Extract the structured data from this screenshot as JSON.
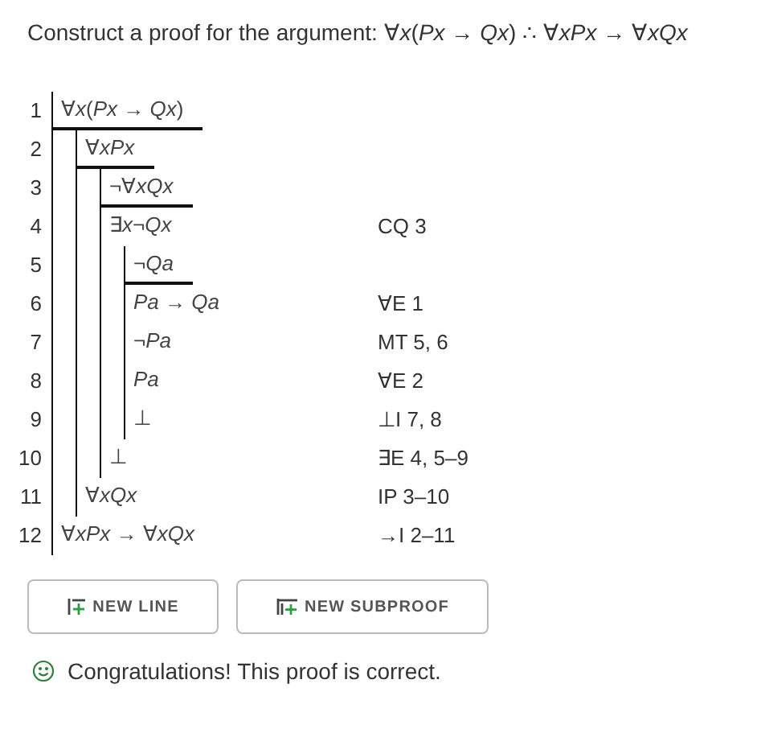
{
  "prompt": "Construct a proof for the argument: ∀*x*(*Px* → *Qx*) ∴ ∀*xPx* → ∀*xQx*",
  "proof": {
    "assumptions": [
      {
        "number": "1",
        "formula": "∀*x*(*Px* → *Qx*)"
      }
    ],
    "items": [
      {
        "kind": "subproof",
        "assumptions": [
          {
            "number": "2",
            "formula": "∀*xPx*"
          }
        ],
        "items": [
          {
            "kind": "subproof",
            "assumptions": [
              {
                "number": "3",
                "formula": "¬∀*xQx*"
              }
            ],
            "items": [
              {
                "kind": "line",
                "number": "4",
                "formula": "∃*x*¬*Qx*",
                "justification": "CQ 3"
              },
              {
                "kind": "subproof",
                "assumptions": [
                  {
                    "number": "5",
                    "formula": "¬*Qa*"
                  }
                ],
                "items": [
                  {
                    "kind": "line",
                    "number": "6",
                    "formula": "*Pa* → *Qa*",
                    "justification": "∀E 1"
                  },
                  {
                    "kind": "line",
                    "number": "7",
                    "formula": "¬*Pa*",
                    "justification": "MT 5, 6"
                  },
                  {
                    "kind": "line",
                    "number": "8",
                    "formula": "*Pa*",
                    "justification": "∀E 2"
                  },
                  {
                    "kind": "line",
                    "number": "9",
                    "formula": "⊥",
                    "justification": "⊥I 7, 8"
                  }
                ]
              },
              {
                "kind": "line",
                "number": "10",
                "formula": "⊥",
                "justification": "∃E 4, 5–9"
              }
            ]
          },
          {
            "kind": "line",
            "number": "11",
            "formula": "∀*xQx*",
            "justification": "IP 3–10"
          }
        ]
      },
      {
        "kind": "line",
        "number": "12",
        "formula": "∀*xPx* → ∀*xQx*",
        "justification": "→I 2–11"
      }
    ]
  },
  "buttons": [
    {
      "kind": "line",
      "label": "NEW LINE"
    },
    {
      "kind": "subproof",
      "label": "NEW SUBPROOF"
    }
  ],
  "message": {
    "kind": "success",
    "text": "Congratulations! This proof is correct."
  }
}
